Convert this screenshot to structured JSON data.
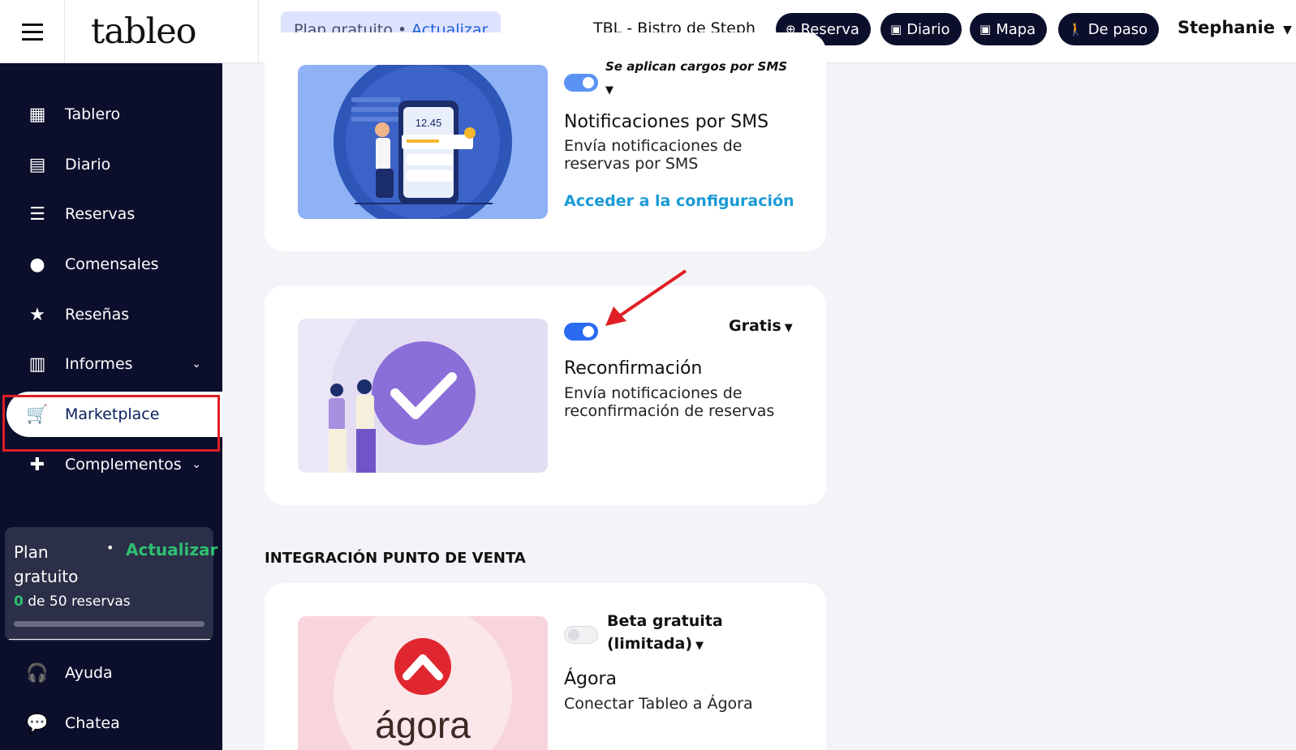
{
  "header": {
    "logo": "tableo",
    "plan": "Plan gratuito",
    "plan_sep": "•",
    "plan_upgrade": "Actualizar",
    "restaurant": "TBL - Bistro de Steph",
    "buttons": [
      {
        "label": "Reserva",
        "icon": "plus-circle-icon"
      },
      {
        "label": "Diario",
        "icon": "calendar-icon"
      },
      {
        "label": "Mapa",
        "icon": "calendar-icon"
      },
      {
        "label": "De paso",
        "icon": "walking-icon"
      }
    ],
    "user": "Stephanie"
  },
  "sidebar": {
    "items": [
      {
        "label": "Tablero",
        "icon": "dashboard-icon"
      },
      {
        "label": "Diario",
        "icon": "book-icon"
      },
      {
        "label": "Reservas",
        "icon": "list-icon"
      },
      {
        "label": "Comensales",
        "icon": "person-icon"
      },
      {
        "label": "Reseñas",
        "icon": "star-icon"
      },
      {
        "label": "Informes",
        "icon": "bar-chart-icon"
      },
      {
        "label": "Marketplace",
        "icon": "cart-icon"
      },
      {
        "label": "Complementos",
        "icon": "puzzle-icon"
      },
      {
        "label": "Ayuda",
        "icon": "headset-icon"
      },
      {
        "label": "Chatea",
        "icon": "chat-icon"
      }
    ],
    "active": "Marketplace",
    "plan_card": {
      "name": "Plan gratuito",
      "upgrade": "Actualizar",
      "count_used": "0",
      "count_text": "de 50 reservas",
      "usage_fraction": 0
    }
  },
  "cards": {
    "sms": {
      "price": "Se aplican cargos por SMS",
      "title": "Notificaciones por SMS",
      "desc_line1": "Envía notificaciones de",
      "desc_line2": "reservas por SMS",
      "link": "Acceder a la configuración",
      "image_time": "12.45",
      "enabled": true
    },
    "reconf": {
      "price": "Gratis",
      "title": "Reconfirmación",
      "desc_line1": "Envía notificaciones de",
      "desc_line2": "reconfirmación de reservas",
      "enabled": true
    },
    "agora": {
      "price_line1": "Beta gratuita",
      "price_line2": "(limitada)",
      "title": "Ágora",
      "desc": "Conectar Tableo a Ágora",
      "image_text": "ágora",
      "enabled": false
    }
  },
  "section_pos": "INTEGRACIÓN PUNTO DE VENTA",
  "colors": {
    "sidebar_bg": "#0b0f2c",
    "accent_blue": "#2a6bf2",
    "link_blue": "#1a9ad6",
    "upgrade_green": "#2fbf71",
    "highlight_red": "#e01e25"
  }
}
